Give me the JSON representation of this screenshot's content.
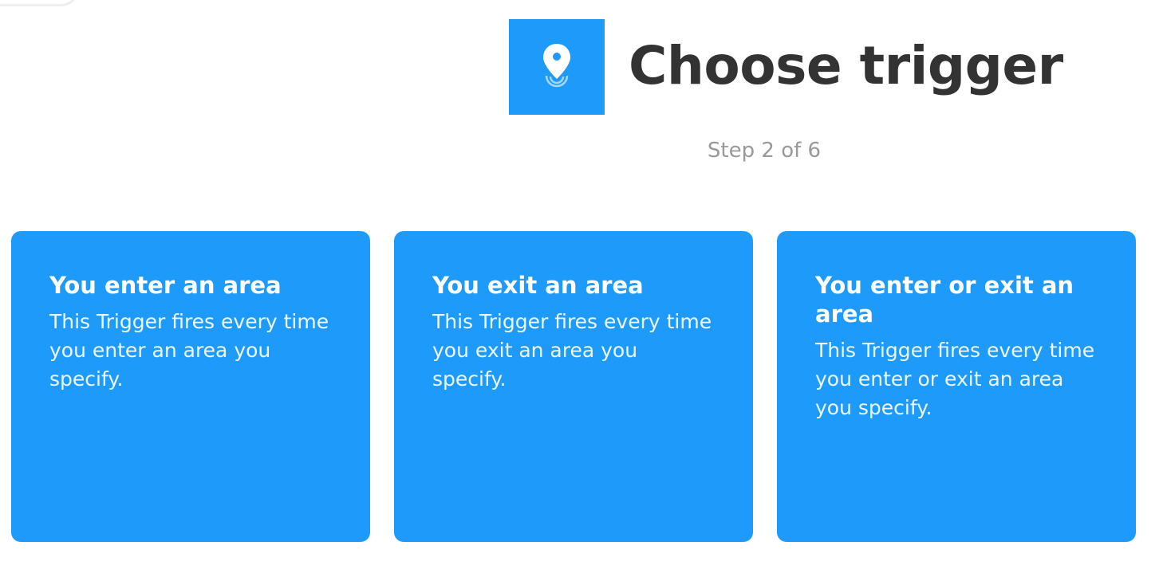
{
  "header": {
    "title": "Choose trigger",
    "step": "Step 2 of 6",
    "icon": "location-pin-icon"
  },
  "colors": {
    "accent": "#1e9bfa",
    "title": "#333333",
    "step": "#999999"
  },
  "triggers": [
    {
      "title": "You enter an area",
      "description": "This Trigger fires every time you enter an area you specify."
    },
    {
      "title": "You exit an area",
      "description": "This Trigger fires every time you exit an area you specify."
    },
    {
      "title": "You enter or exit an area",
      "description": "This Trigger fires every time you enter or exit an area you specify."
    }
  ]
}
